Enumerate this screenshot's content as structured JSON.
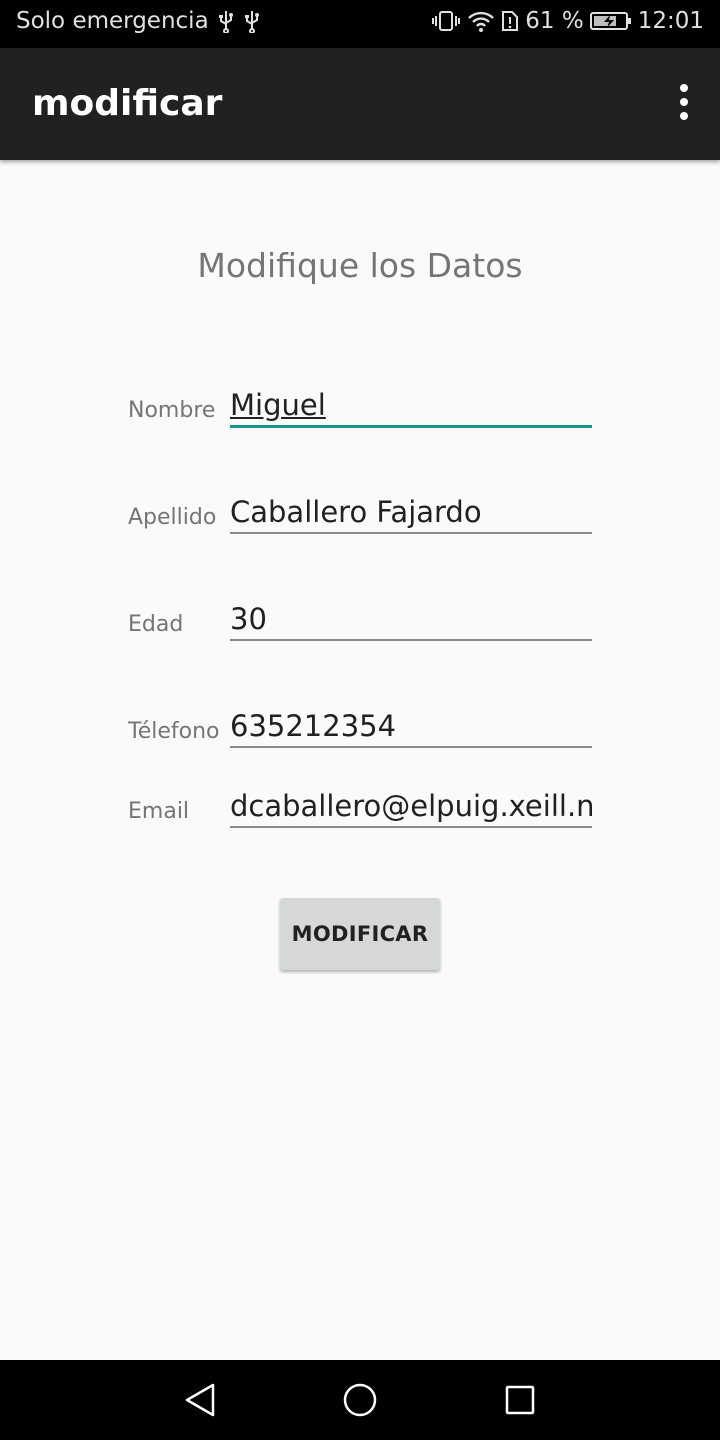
{
  "status_bar": {
    "carrier_text": "Solo emergencia",
    "battery_percent": "61 %",
    "time": "12:01",
    "icons": [
      "usb-icon",
      "usb-icon",
      "vibrate-icon",
      "wifi-icon",
      "sim-alert-icon",
      "battery-charging-icon"
    ]
  },
  "app_bar": {
    "title": "modificar",
    "overflow_icon": "more-vert-icon",
    "background": "#212121"
  },
  "form": {
    "heading": "Modifique los Datos",
    "fields": [
      {
        "label": "Nombre",
        "value": "Miguel",
        "focused": true
      },
      {
        "label": "Apellido",
        "value": "Caballero Fajardo",
        "focused": false
      },
      {
        "label": "Edad",
        "value": "30",
        "focused": false
      },
      {
        "label": "Télefono",
        "value": "635212354",
        "focused": false
      },
      {
        "label": "Email",
        "value": "dcaballero@elpuig.xeill.net",
        "focused": false
      }
    ],
    "submit_label": "MODIFICAR",
    "accent_color": "#159688"
  },
  "nav_bar": {
    "buttons": [
      "back-icon",
      "home-icon",
      "recents-icon"
    ]
  }
}
